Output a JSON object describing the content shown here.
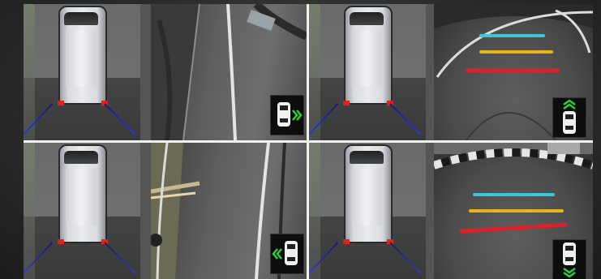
{
  "views": [
    {
      "id": "view-right",
      "camera": "right-side",
      "indicator_icon": "car-arrow-right-icon",
      "arrow_color": "#28d23c"
    },
    {
      "id": "view-front",
      "camera": "front",
      "indicator_icon": "car-arrow-up-icon",
      "arrow_color": "#28d23c"
    },
    {
      "id": "view-left",
      "camera": "left-side",
      "indicator_icon": "car-arrow-left-icon",
      "arrow_color": "#28d23c"
    },
    {
      "id": "view-rear",
      "camera": "rear",
      "indicator_icon": "car-arrow-down-icon",
      "arrow_color": "#28d23c"
    }
  ],
  "guide_colors": {
    "near": "#d8232a",
    "middle": "#e8b419",
    "far": "#3fc6d6",
    "side": "#2438d0"
  }
}
